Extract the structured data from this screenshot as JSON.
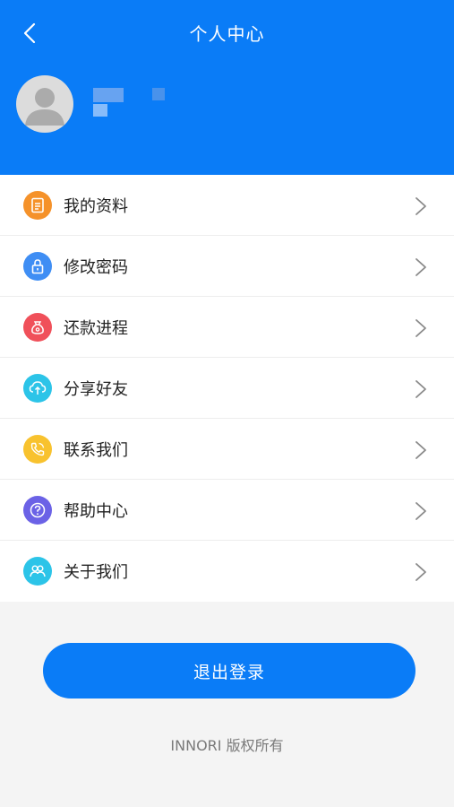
{
  "header": {
    "title": "个人中心",
    "back_icon": "chevron-left-icon",
    "bg_color": "#0a7cf7"
  },
  "profile": {
    "avatar_icon": "user-avatar-icon"
  },
  "menu": {
    "items": [
      {
        "label": "我的资料",
        "icon": "document-icon",
        "color": "#f5922a"
      },
      {
        "label": "修改密码",
        "icon": "lock-icon",
        "color": "#3f8ef4"
      },
      {
        "label": "还款进程",
        "icon": "money-bag-icon",
        "color": "#f0505a"
      },
      {
        "label": "分享好友",
        "icon": "share-cloud-icon",
        "color": "#2cc4e8"
      },
      {
        "label": "联系我们",
        "icon": "phone-icon",
        "color": "#f8c22e"
      },
      {
        "label": "帮助中心",
        "icon": "help-icon",
        "color": "#6b62e6"
      },
      {
        "label": "关于我们",
        "icon": "group-icon",
        "color": "#2cc4e8"
      }
    ]
  },
  "logout_label": "退出登录",
  "copyright": "INNORI 版权所有"
}
